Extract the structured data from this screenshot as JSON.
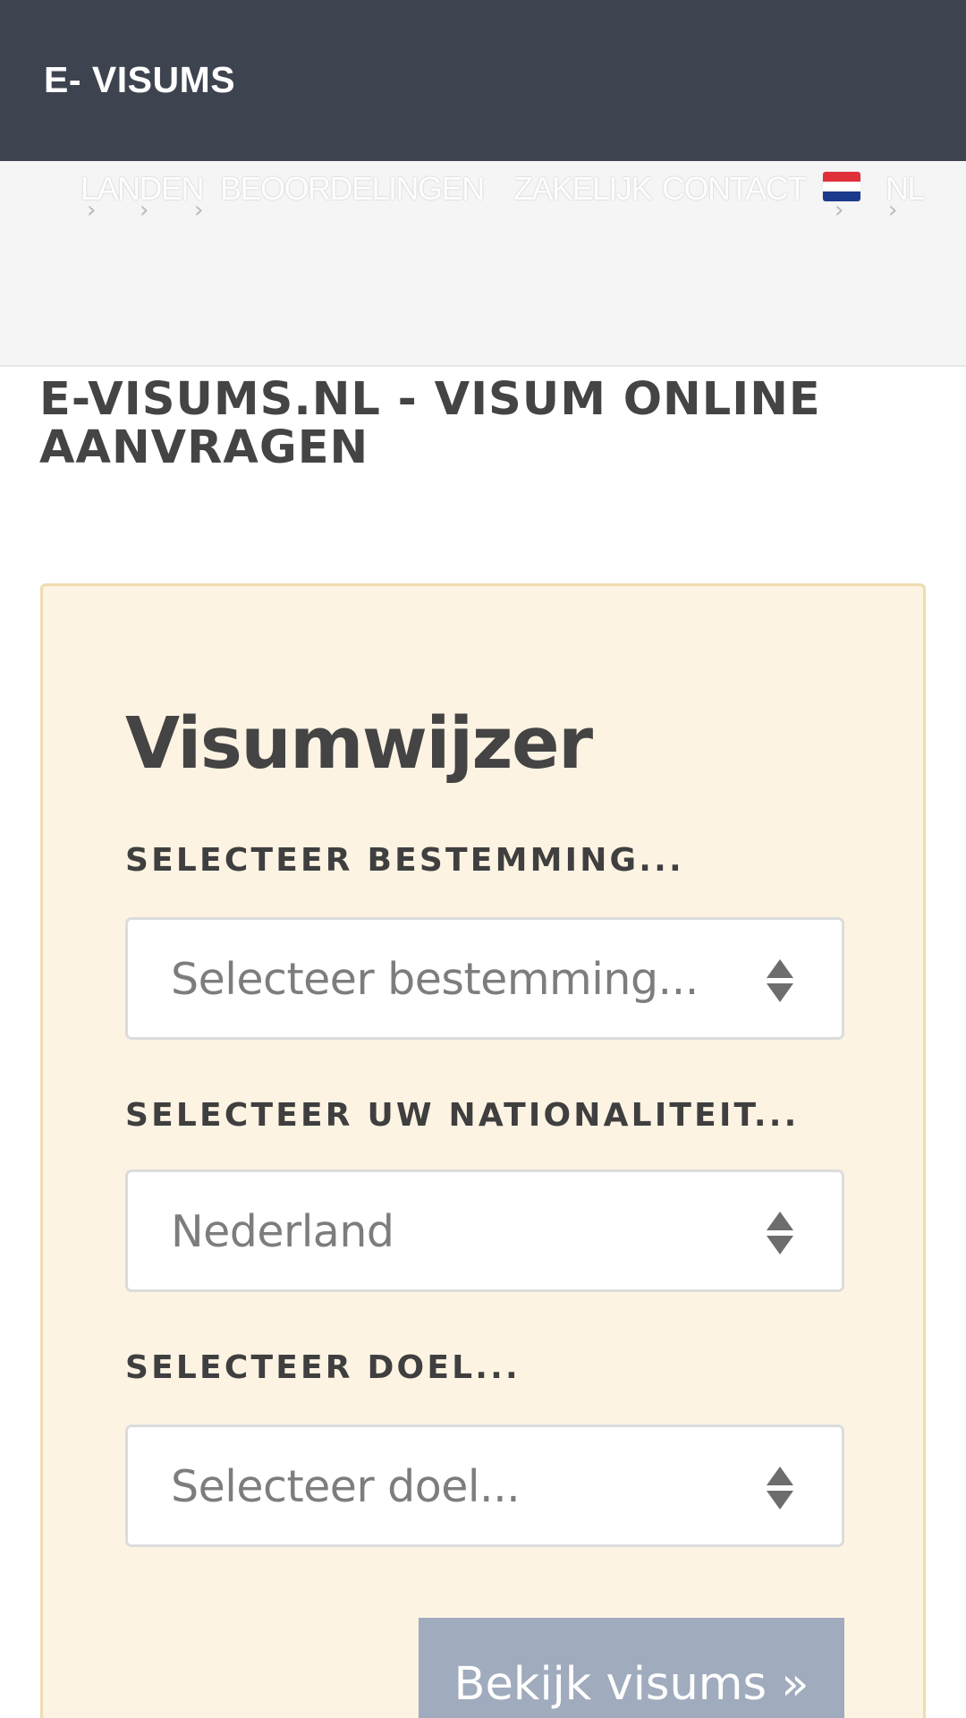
{
  "header": {
    "brand": "E- VISUMS"
  },
  "nav": {
    "items": [
      {
        "label": "LANDEN"
      },
      {
        "label": "BEOORDELINGEN"
      },
      {
        "label": "ZAKELIJK"
      },
      {
        "label": "CONTACT"
      },
      {
        "label": "NL"
      }
    ],
    "flag_icon": "netherlands-flag-icon"
  },
  "page": {
    "title": "E-VISUMS.NL - VISUM ONLINE AANVRAGEN"
  },
  "visa_finder": {
    "title": "Visumwijzer",
    "destination": {
      "label": "SELECTEER BESTEMMING...",
      "value": "Selecteer bestemming..."
    },
    "nationality": {
      "label": "SELECTEER UW NATIONALITEIT...",
      "value": "Nederland"
    },
    "purpose": {
      "label": "SELECTEER DOEL...",
      "value": "Selecteer doel..."
    },
    "submit_label": "Bekijk visums »"
  },
  "colors": {
    "header_bg": "#3e4350",
    "title_bar_bg": "#f5f5f5",
    "card_bg": "#fdf3e3",
    "card_border": "#efdcaf",
    "button_bg": "#a0abbd"
  }
}
